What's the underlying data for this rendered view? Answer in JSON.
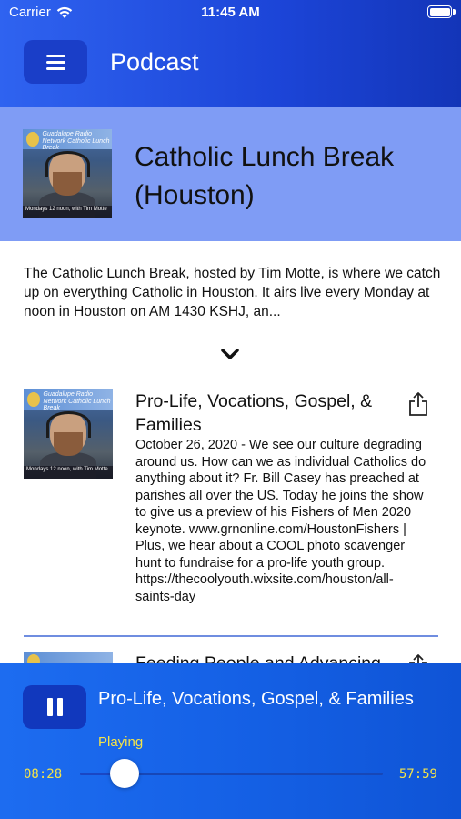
{
  "status_bar": {
    "carrier": "Carrier",
    "time": "11:45 AM",
    "wifi_icon": "wifi-icon",
    "battery_icon": "battery-icon"
  },
  "header": {
    "title": "Podcast",
    "menu_icon": "hamburger-menu-icon"
  },
  "podcast": {
    "cover_title": "Guadalupe Radio Network Catholic Lunch Break",
    "cover_caption": "Mondays 12 noon, with Tim Motte",
    "title": "Catholic Lunch Break (Houston)",
    "description": "The Catholic Lunch Break, hosted by Tim Motte, is where we catch up on everything Catholic in Houston. It airs live every Monday at noon in Houston on AM 1430 KSHJ, an...",
    "expand_icon": "chevron-down-icon"
  },
  "episodes": [
    {
      "title": "Pro-Life, Vocations, Gospel, & Families",
      "description": "October 26, 2020 - We see our culture degrading around us. How can we as individual Catholics do anything about it? Fr. Bill Casey has preached at parishes all over the US. Today he joins the show to give us a preview of his Fishers of Men 2020 keynote. www.grnonline.com/HoustonFishers | Plus, we hear about a COOL photo scavenger hunt to fundraise for a pro-life youth group. https://thecoolyouth.wixsite.com/houston/all-saints-day",
      "share_icon": "share-icon"
    },
    {
      "title": "Feeding People and Advancing",
      "share_icon": "share-icon"
    }
  ],
  "player": {
    "title": "Pro-Life, Vocations, Gospel, & Families",
    "status": "Playing",
    "elapsed": "08:28",
    "duration": "57:59",
    "progress": 0.146,
    "pause_icon": "pause-icon",
    "colors": {
      "status": "#f3e34a",
      "background": "#1561e6"
    }
  }
}
